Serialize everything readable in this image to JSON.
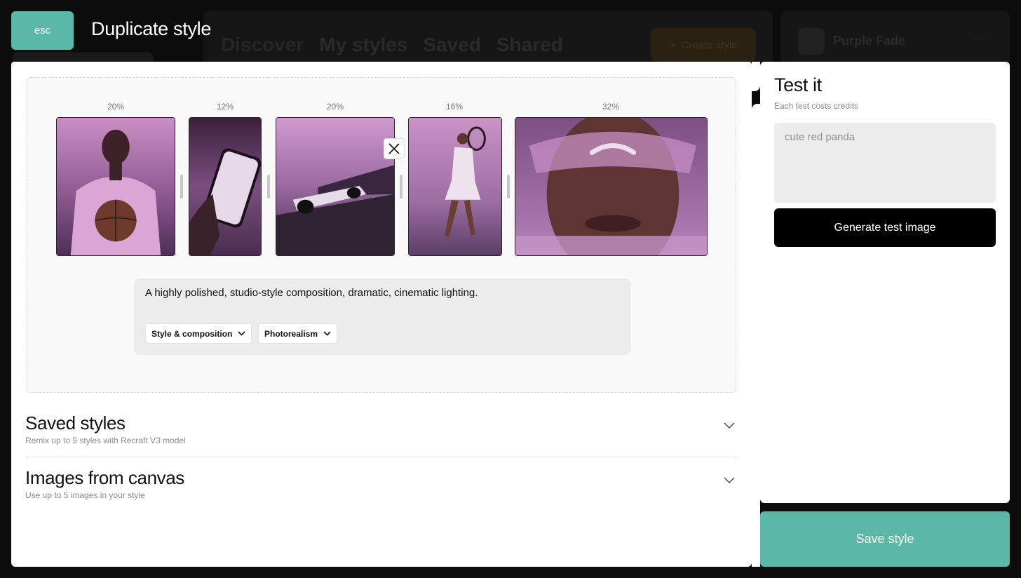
{
  "header": {
    "esc_label": "esc",
    "title": "Duplicate style"
  },
  "background_app": {
    "tabs": [
      "Discover",
      "My styles",
      "Saved",
      "Shared"
    ],
    "create_label": "Create style",
    "style_name": "Purple Fade"
  },
  "style_images": [
    {
      "weight": "20%",
      "subject": "basketball-player"
    },
    {
      "weight": "12%",
      "subject": "hand-holding-phone"
    },
    {
      "weight": "20%",
      "subject": "race-car"
    },
    {
      "weight": "16%",
      "subject": "tennis-player"
    },
    {
      "weight": "32%",
      "subject": "face-with-sunglasses"
    }
  ],
  "prompt": {
    "text": "A highly polished, studio-style composition, dramatic, cinematic lighting.",
    "chips": [
      "Style & composition",
      "Photorealism"
    ]
  },
  "sections": {
    "saved": {
      "title": "Saved styles",
      "subtitle": "Remix up to 5 styles with Recraft V3 model"
    },
    "canvas": {
      "title": "Images from canvas",
      "subtitle": "Use up to 5 images in your style"
    }
  },
  "test": {
    "title": "Test it",
    "subtitle": "Each test costs credits",
    "placeholder": "cute red panda",
    "generate_label": "Generate test image"
  },
  "save_label": "Save style",
  "colors": {
    "accent": "#5cb8a6",
    "photo_tint": "#b57fb3",
    "background": "#0c0c0c"
  }
}
